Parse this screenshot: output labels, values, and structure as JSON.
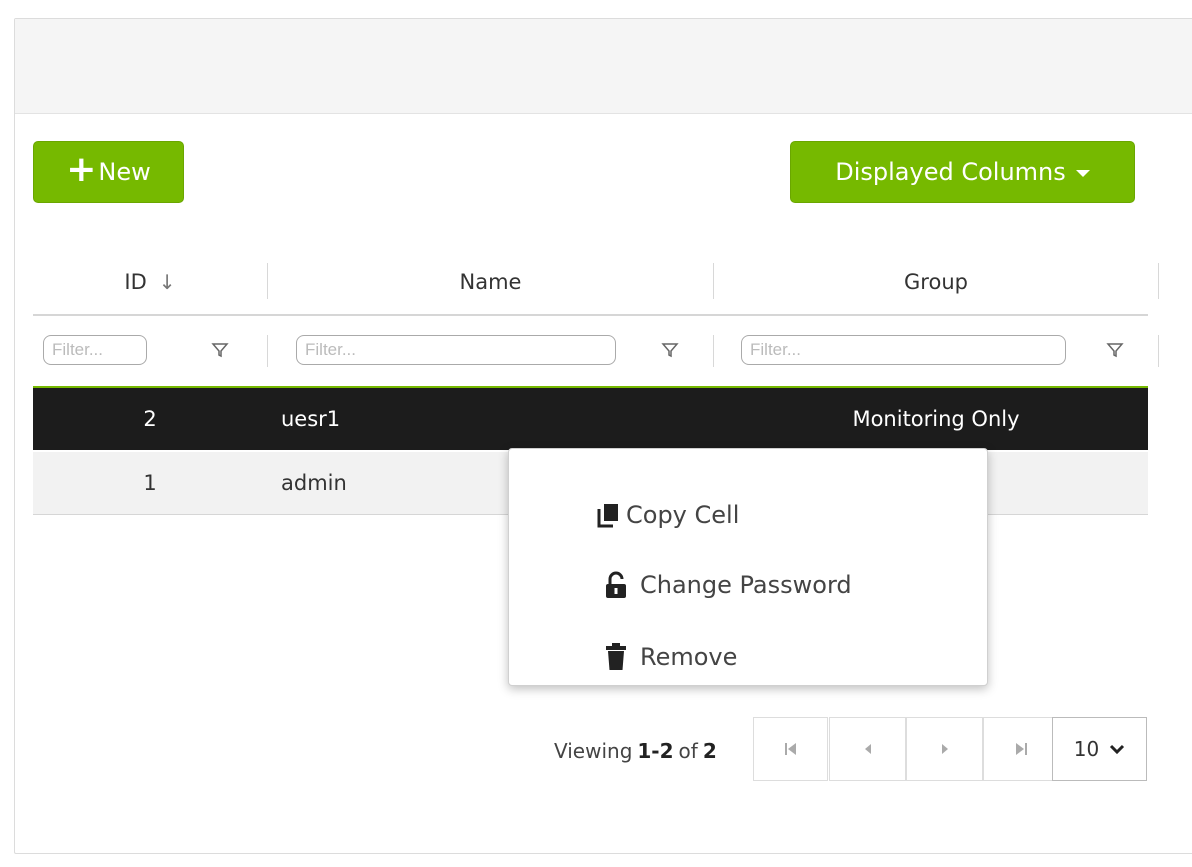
{
  "toolbar": {
    "new_label": "New",
    "new_icon": "plus-icon",
    "displayed_columns_label": "Displayed Columns",
    "accent_color": "#76b900"
  },
  "table": {
    "columns": [
      {
        "label": "ID",
        "sort": "desc"
      },
      {
        "label": "Name"
      },
      {
        "label": "Group"
      }
    ],
    "filter_placeholder": "Filter...",
    "rows": [
      {
        "id": "2",
        "name": "uesr1",
        "group": "Monitoring Only",
        "selected": true
      },
      {
        "id": "1",
        "name": "admin",
        "group": ""
      }
    ]
  },
  "context_menu": {
    "items": [
      {
        "label": "Copy Cell",
        "icon": "copy-icon"
      },
      {
        "label": "Change Password",
        "icon": "unlock-icon"
      },
      {
        "label": "Remove",
        "icon": "trash-icon"
      }
    ]
  },
  "pagination": {
    "viewing_prefix": "Viewing",
    "range": "1-2",
    "of_label": "of",
    "total": "2",
    "page_size": "10"
  }
}
